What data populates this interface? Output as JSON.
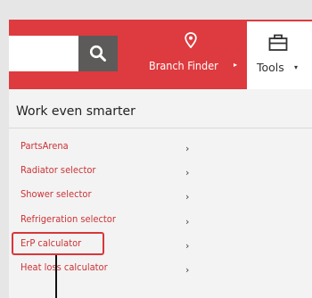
{
  "header": {
    "search": {
      "value": "",
      "placeholder": ""
    },
    "search_icon": "search-icon",
    "branch_finder": {
      "label": "Branch Finder",
      "caret": "▸",
      "icon": "map-pin-icon"
    },
    "tools": {
      "label": "Tools",
      "caret": "▾",
      "icon": "briefcase-icon"
    }
  },
  "panel": {
    "title": "Work even smarter",
    "items": [
      {
        "label": "PartsArena",
        "chevron": "›"
      },
      {
        "label": "Radiator selector",
        "chevron": "›"
      },
      {
        "label": "Shower selector",
        "chevron": "›"
      },
      {
        "label": "Refrigeration selector",
        "chevron": "›"
      },
      {
        "label": "ErP calculator",
        "chevron": "›"
      },
      {
        "label": "Heat loss calculator",
        "chevron": "›"
      }
    ]
  },
  "colors": {
    "brand_red": "#dd3b3f",
    "link_red": "#cc3336",
    "search_button": "#5d5b5a",
    "highlight": "#d9363a"
  }
}
